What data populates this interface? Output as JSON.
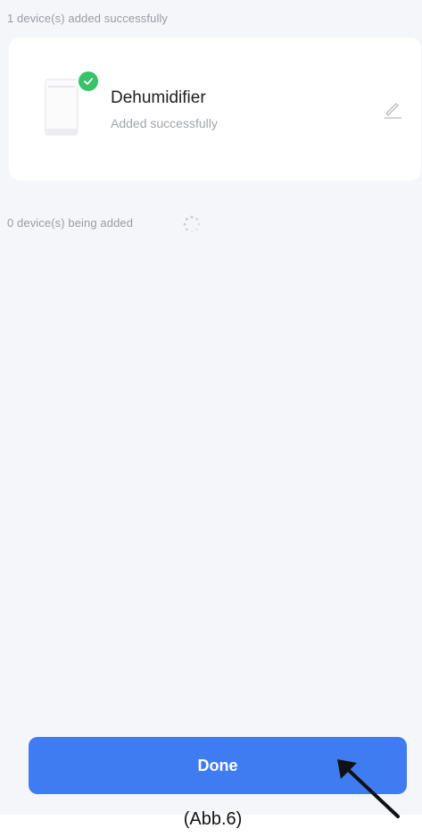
{
  "added_section": {
    "label": "1 device(s) added successfully"
  },
  "device": {
    "name": "Dehumidifier",
    "status": "Added successfully",
    "image_icon": "dehumidifier-device-icon",
    "badge_icon": "check-circle-icon",
    "edit_icon": "pencil-icon"
  },
  "adding_section": {
    "label": "0 device(s) being added",
    "spinner_icon": "loading-spinner-icon"
  },
  "done_button": {
    "label": "Done"
  },
  "annotation": {
    "caption": "(Abb.6)",
    "arrow_icon": "arrow-pointer-icon"
  },
  "colors": {
    "primary": "#3f7cf2",
    "success": "#39c16c",
    "background": "#f5f6fa",
    "muted_text": "#9a9ca3"
  }
}
